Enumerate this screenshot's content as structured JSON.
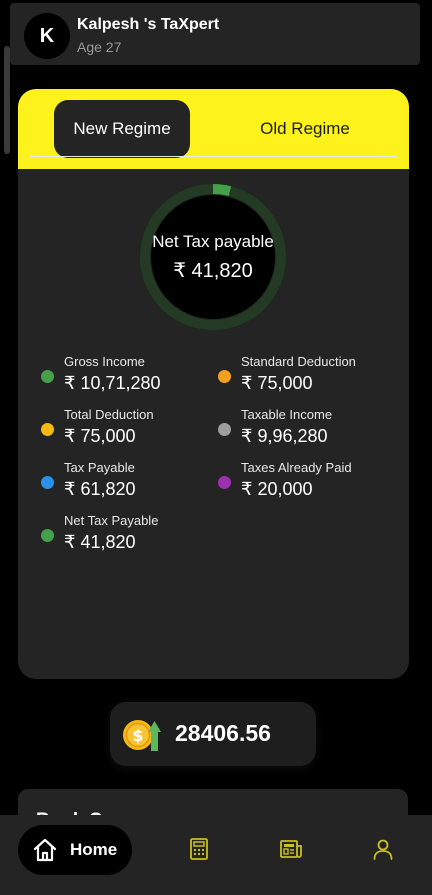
{
  "header": {
    "avatar_letter": "K",
    "name": "Kalpesh 's TaXpert",
    "age": "Age 27"
  },
  "tabs": {
    "new": "New Regime",
    "old": "Old Regime",
    "selected": "new"
  },
  "summary": {
    "label": "Net Tax payable",
    "value": "₹ 41,820",
    "ring_fraction": 0.04
  },
  "stats": [
    {
      "label": "Gross Income",
      "value": "₹ 10,71,280",
      "color": "#46a049"
    },
    {
      "label": "Standard Deduction",
      "value": "₹ 75,000",
      "color": "#f5a01c"
    },
    {
      "label": "Total Deduction",
      "value": "₹ 75,000",
      "color": "#f5b914"
    },
    {
      "label": "Taxable Income",
      "value": "₹ 9,96,280",
      "color": "#9e9e9e"
    },
    {
      "label": "Tax Payable",
      "value": "₹ 61,820",
      "color": "#2a90e8"
    },
    {
      "label": "Taxes Already Paid",
      "value": "₹ 20,000",
      "color": "#9c30b0"
    },
    {
      "label": "Net Tax Payable",
      "value": "₹ 41,820",
      "color": "#46a049"
    }
  ],
  "coins": {
    "value": "28406.56",
    "icon": "coin-growth-icon"
  },
  "book_card": {
    "title": "Book Ca..."
  },
  "nav": {
    "home_label": "Home",
    "items": [
      "home-icon",
      "calculator-icon",
      "news-icon",
      "profile-icon"
    ]
  },
  "colors": {
    "accent": "#fdf21c",
    "card": "#242424",
    "nav_icon": "#c8c020"
  }
}
